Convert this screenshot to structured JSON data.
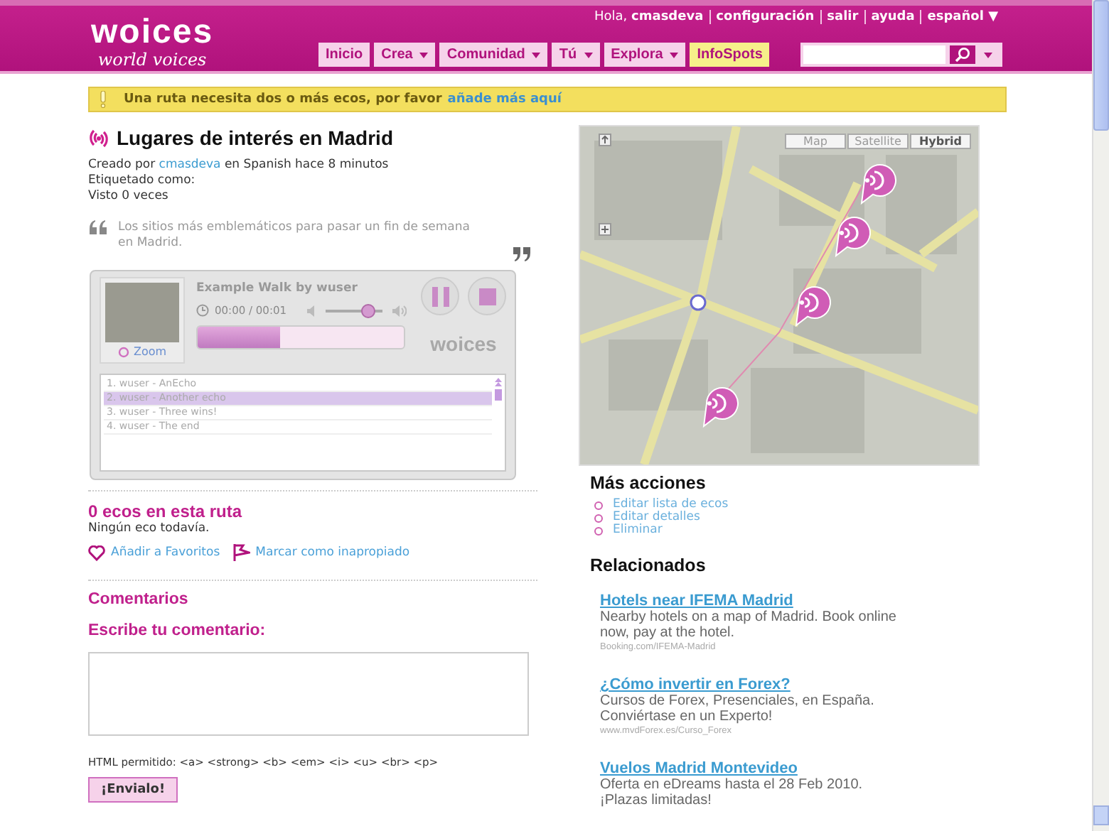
{
  "header": {
    "logo": "woices",
    "tagline": "world voices",
    "greeting": "Hola, **cmasdeva**",
    "user_links": [
      "configuración",
      "salir",
      "ayuda",
      "español ▼"
    ],
    "nav": [
      {
        "label": "Inicio",
        "dropdown": false,
        "highlighted": false
      },
      {
        "label": "Crea",
        "dropdown": true,
        "highlighted": false
      },
      {
        "label": "Comunidad",
        "dropdown": true,
        "highlighted": false
      },
      {
        "label": "Tú",
        "dropdown": true,
        "highlighted": false
      },
      {
        "label": "Explora",
        "dropdown": true,
        "highlighted": false
      },
      {
        "label": "InfoSpots",
        "dropdown": false,
        "highlighted": true
      }
    ]
  },
  "alert": {
    "text": "Una ruta necesita dos o más ecos, por favor",
    "link": "añade más aquí"
  },
  "route": {
    "title": "Lugares de interés en Madrid",
    "created": {
      "prefix": "Creado por",
      "author": "cmasdeva",
      "suffix": "en Spanish hace 8 minutos"
    },
    "tagged": "Etiquetado como:",
    "views": "Visto 0 veces",
    "description": "Los sitios más emblemáticos para pasar un fin de semana en Madrid."
  },
  "player": {
    "title": "Example Walk by wuser",
    "time": "00:00 / 00:01",
    "zoom": "Zoom",
    "logo": "woices",
    "playing": true,
    "progress": {
      "level": 0.4
    },
    "volume": {
      "level": 0.75
    },
    "playlist": [
      {
        "label": "1. wuser - AnEcho",
        "selected": false
      },
      {
        "label": "2. wuser - Another echo",
        "selected": true
      },
      {
        "label": "3. wuser - Three wins!",
        "selected": false
      },
      {
        "label": "4. wuser - The end",
        "selected": false
      }
    ]
  },
  "echoes": {
    "heading": "0 ecos en esta ruta",
    "empty": "Ningún eco todavía.",
    "actions": [
      {
        "kind": "favorite",
        "label": "Añadir a Favoritos"
      },
      {
        "kind": "flag",
        "label": "Marcar como inapropiado"
      }
    ]
  },
  "comments": {
    "heading": "Comentarios",
    "form_heading": "Escribe tu comentario:",
    "allowed_html": "HTML permitido: <a> <strong> <b> <em> <i> <u> <br> <p>",
    "submit": "¡Envialo!"
  },
  "map": {
    "types": [
      {
        "label": "Map",
        "selected": false
      },
      {
        "label": "Satellite",
        "selected": false
      },
      {
        "label": "Hybrid",
        "selected": true
      }
    ]
  },
  "more_actions": {
    "heading": "Más acciones",
    "items": [
      "Editar lista de ecos",
      "Editar detalles",
      "Eliminar"
    ]
  },
  "related": {
    "heading": "Relacionados",
    "ads": [
      {
        "title": "Hotels near IFEMA Madrid",
        "text": "Nearby hotels on a map of Madrid. Book online now, pay at the hotel.",
        "url": "Booking.com/IFEMA-Madrid"
      },
      {
        "title": "¿Cómo invertir en Forex?",
        "text": "Cursos de Forex, Presenciales, en España. Conviértase en un Experto!",
        "url": "www.mvdForex.es/Curso_Forex"
      },
      {
        "title": "Vuelos Madrid Montevideo",
        "text": "Oferta en eDreams hasta el 28 Feb 2010. ¡Plazas limitadas!"
      }
    ]
  }
}
